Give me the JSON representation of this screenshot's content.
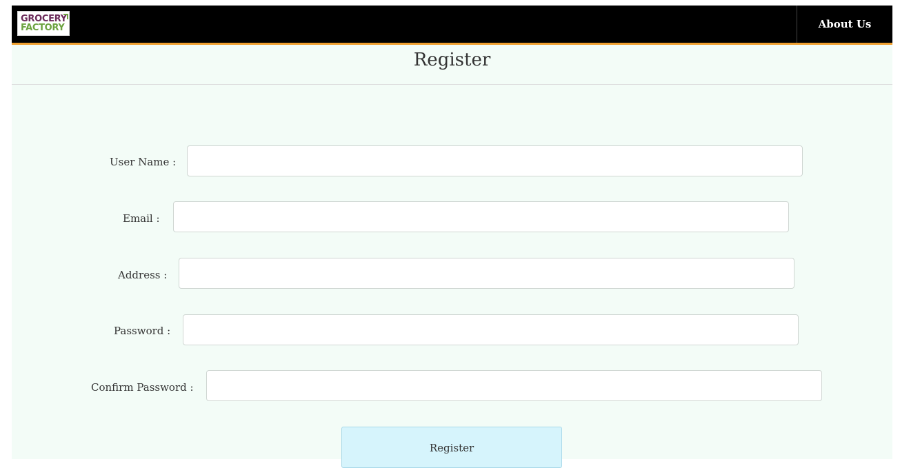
{
  "navbar": {
    "logo": {
      "line1": "GROCERY",
      "line2": "FACTORY"
    },
    "about_link": "About Us"
  },
  "page": {
    "title": "Register"
  },
  "form": {
    "user_name": {
      "label": "User Name :",
      "value": ""
    },
    "email": {
      "label": "Email :",
      "value": ""
    },
    "address": {
      "label": "Address :",
      "value": ""
    },
    "password": {
      "label": "Password :",
      "value": ""
    },
    "confirm_password": {
      "label": "Confirm Password :",
      "value": ""
    },
    "submit_label": "Register"
  },
  "colors": {
    "navbar_bg": "#000000",
    "navbar_accent": "#f0a030",
    "page_bg": "#f3fcf7",
    "button_bg": "#d6f4fc",
    "logo_purple": "#6b2b5a",
    "logo_green": "#6ca23f"
  }
}
